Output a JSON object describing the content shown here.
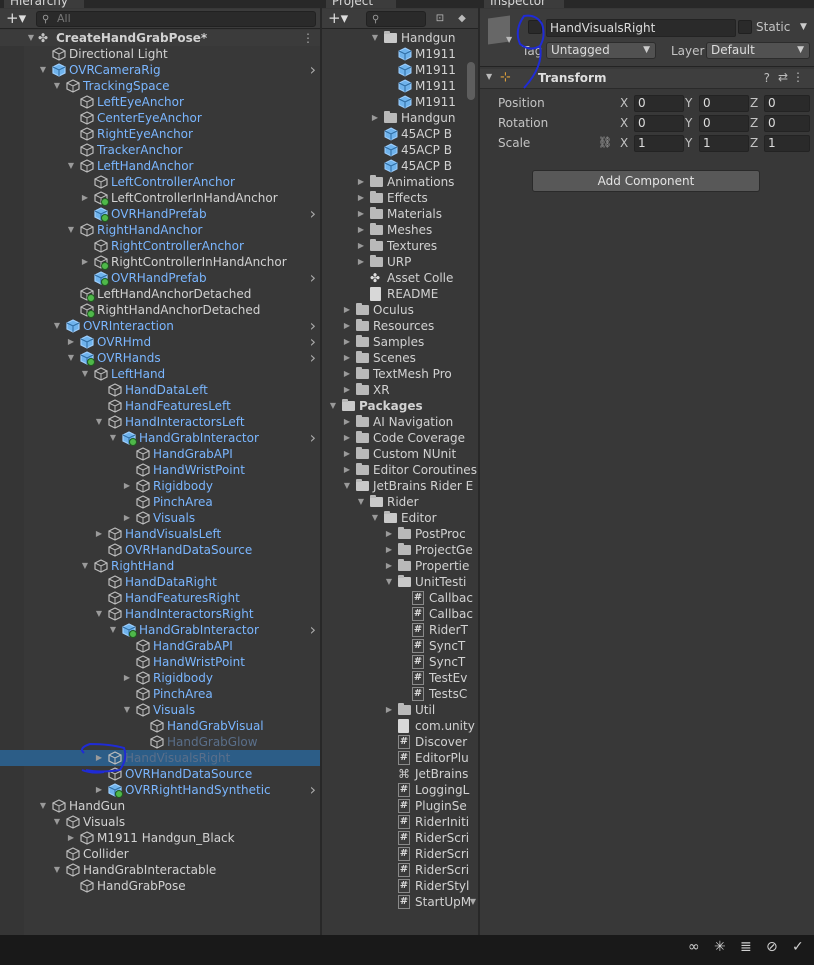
{
  "hierarchy": {
    "tab": "Hierarchy",
    "search_placeholder": "All",
    "scene": "CreateHandGrabPose*",
    "rows": [
      {
        "label": "Directional Light",
        "depth": 1,
        "color": "white",
        "arrow": "",
        "icon": "cube"
      },
      {
        "label": "OVRCameraRig",
        "depth": 1,
        "color": "blue",
        "arrow": "down",
        "icon": "prefab",
        "chev": true
      },
      {
        "label": "TrackingSpace",
        "depth": 2,
        "color": "blue",
        "arrow": "down",
        "icon": "cube"
      },
      {
        "label": "LeftEyeAnchor",
        "depth": 3,
        "color": "blue",
        "arrow": "",
        "icon": "cube"
      },
      {
        "label": "CenterEyeAnchor",
        "depth": 3,
        "color": "blue",
        "arrow": "",
        "icon": "cube"
      },
      {
        "label": "RightEyeAnchor",
        "depth": 3,
        "color": "blue",
        "arrow": "",
        "icon": "cube"
      },
      {
        "label": "TrackerAnchor",
        "depth": 3,
        "color": "blue",
        "arrow": "",
        "icon": "cube"
      },
      {
        "label": "LeftHandAnchor",
        "depth": 3,
        "color": "blue",
        "arrow": "down",
        "icon": "cube"
      },
      {
        "label": "LeftControllerAnchor",
        "depth": 4,
        "color": "blue",
        "arrow": "",
        "icon": "cube"
      },
      {
        "label": "LeftControllerInHandAnchor",
        "depth": 4,
        "color": "white",
        "arrow": "right",
        "icon": "cube-add"
      },
      {
        "label": "OVRHandPrefab",
        "depth": 4,
        "color": "blue",
        "arrow": "",
        "icon": "prefab-add",
        "chev": true
      },
      {
        "label": "RightHandAnchor",
        "depth": 3,
        "color": "blue",
        "arrow": "down",
        "icon": "cube"
      },
      {
        "label": "RightControllerAnchor",
        "depth": 4,
        "color": "blue",
        "arrow": "",
        "icon": "cube"
      },
      {
        "label": "RightControllerInHandAnchor",
        "depth": 4,
        "color": "white",
        "arrow": "right",
        "icon": "cube-add"
      },
      {
        "label": "OVRHandPrefab",
        "depth": 4,
        "color": "blue",
        "arrow": "",
        "icon": "prefab-add",
        "chev": true
      },
      {
        "label": "LeftHandAnchorDetached",
        "depth": 3,
        "color": "white",
        "arrow": "",
        "icon": "cube-add"
      },
      {
        "label": "RightHandAnchorDetached",
        "depth": 3,
        "color": "white",
        "arrow": "",
        "icon": "cube-add"
      },
      {
        "label": "OVRInteraction",
        "depth": 2,
        "color": "blue",
        "arrow": "down",
        "icon": "prefab",
        "chev": true
      },
      {
        "label": "OVRHmd",
        "depth": 3,
        "color": "blue",
        "arrow": "right",
        "icon": "prefab",
        "chev": true
      },
      {
        "label": "OVRHands",
        "depth": 3,
        "color": "blue",
        "arrow": "down",
        "icon": "prefab-add",
        "chev": true
      },
      {
        "label": "LeftHand",
        "depth": 4,
        "color": "blue",
        "arrow": "down",
        "icon": "cube"
      },
      {
        "label": "HandDataLeft",
        "depth": 5,
        "color": "blue",
        "arrow": "",
        "icon": "cube"
      },
      {
        "label": "HandFeaturesLeft",
        "depth": 5,
        "color": "blue",
        "arrow": "",
        "icon": "cube"
      },
      {
        "label": "HandInteractorsLeft",
        "depth": 5,
        "color": "blue",
        "arrow": "down",
        "icon": "cube"
      },
      {
        "label": "HandGrabInteractor",
        "depth": 6,
        "color": "blue",
        "arrow": "down",
        "icon": "prefab-add",
        "chev": true
      },
      {
        "label": "HandGrabAPI",
        "depth": 7,
        "color": "blue",
        "arrow": "",
        "icon": "cube"
      },
      {
        "label": "HandWristPoint",
        "depth": 7,
        "color": "blue",
        "arrow": "",
        "icon": "cube"
      },
      {
        "label": "Rigidbody",
        "depth": 7,
        "color": "blue",
        "arrow": "right",
        "icon": "cube"
      },
      {
        "label": "PinchArea",
        "depth": 7,
        "color": "blue",
        "arrow": "",
        "icon": "cube"
      },
      {
        "label": "Visuals",
        "depth": 7,
        "color": "blue",
        "arrow": "right",
        "icon": "cube"
      },
      {
        "label": "HandVisualsLeft",
        "depth": 5,
        "color": "blue",
        "arrow": "right",
        "icon": "cube"
      },
      {
        "label": "OVRHandDataSource",
        "depth": 5,
        "color": "blue",
        "arrow": "",
        "icon": "cube"
      },
      {
        "label": "RightHand",
        "depth": 4,
        "color": "blue",
        "arrow": "down",
        "icon": "cube"
      },
      {
        "label": "HandDataRight",
        "depth": 5,
        "color": "blue",
        "arrow": "",
        "icon": "cube"
      },
      {
        "label": "HandFeaturesRight",
        "depth": 5,
        "color": "blue",
        "arrow": "",
        "icon": "cube"
      },
      {
        "label": "HandInteractorsRight",
        "depth": 5,
        "color": "blue",
        "arrow": "down",
        "icon": "cube"
      },
      {
        "label": "HandGrabInteractor",
        "depth": 6,
        "color": "blue",
        "arrow": "down",
        "icon": "prefab-add",
        "chev": true
      },
      {
        "label": "HandGrabAPI",
        "depth": 7,
        "color": "blue",
        "arrow": "",
        "icon": "cube"
      },
      {
        "label": "HandWristPoint",
        "depth": 7,
        "color": "blue",
        "arrow": "",
        "icon": "cube"
      },
      {
        "label": "Rigidbody",
        "depth": 7,
        "color": "blue",
        "arrow": "right",
        "icon": "cube"
      },
      {
        "label": "PinchArea",
        "depth": 7,
        "color": "blue",
        "arrow": "",
        "icon": "cube"
      },
      {
        "label": "Visuals",
        "depth": 7,
        "color": "blue",
        "arrow": "down",
        "icon": "cube"
      },
      {
        "label": "HandGrabVisual",
        "depth": 8,
        "color": "blue",
        "arrow": "",
        "icon": "cube"
      },
      {
        "label": "HandGrabGlow",
        "depth": 8,
        "color": "dim",
        "arrow": "",
        "icon": "cube"
      },
      {
        "label": "HandVisualsRight",
        "depth": 5,
        "color": "dim",
        "arrow": "right",
        "icon": "cube",
        "selected": true
      },
      {
        "label": "OVRHandDataSource",
        "depth": 5,
        "color": "blue",
        "arrow": "",
        "icon": "cube"
      },
      {
        "label": "OVRRightHandSynthetic",
        "depth": 5,
        "color": "blue",
        "arrow": "right",
        "icon": "prefab-add",
        "chev": true
      },
      {
        "label": "HandGun",
        "depth": 1,
        "color": "white",
        "arrow": "down",
        "icon": "cube"
      },
      {
        "label": "Visuals",
        "depth": 2,
        "color": "white",
        "arrow": "down",
        "icon": "cube"
      },
      {
        "label": "M1911 Handgun_Black",
        "depth": 3,
        "color": "white",
        "arrow": "right",
        "icon": "cube"
      },
      {
        "label": "Collider",
        "depth": 2,
        "color": "white",
        "arrow": "",
        "icon": "cube"
      },
      {
        "label": "HandGrabInteractable",
        "depth": 2,
        "color": "white",
        "arrow": "down",
        "icon": "cube"
      },
      {
        "label": "HandGrabPose",
        "depth": 3,
        "color": "white",
        "arrow": "",
        "icon": "cube"
      }
    ]
  },
  "project": {
    "tab": "Project",
    "rows": [
      {
        "label": "Handgun",
        "indent": 3,
        "arrow": "down",
        "icon": "folder"
      },
      {
        "label": "M1911",
        "indent": 4,
        "arrow": "",
        "icon": "mesh"
      },
      {
        "label": "M1911",
        "indent": 4,
        "arrow": "",
        "icon": "mesh"
      },
      {
        "label": "M1911",
        "indent": 4,
        "arrow": "",
        "icon": "mesh"
      },
      {
        "label": "M1911",
        "indent": 4,
        "arrow": "",
        "icon": "mesh"
      },
      {
        "label": "Handgun",
        "indent": 3,
        "arrow": "right",
        "icon": "folder"
      },
      {
        "label": "45ACP B",
        "indent": 3,
        "arrow": "",
        "icon": "prefab"
      },
      {
        "label": "45ACP B",
        "indent": 3,
        "arrow": "",
        "icon": "prefab"
      },
      {
        "label": "45ACP B",
        "indent": 3,
        "arrow": "",
        "icon": "prefab"
      },
      {
        "label": "Animations",
        "indent": 2,
        "arrow": "right",
        "icon": "folder"
      },
      {
        "label": "Effects",
        "indent": 2,
        "arrow": "right",
        "icon": "folder"
      },
      {
        "label": "Materials",
        "indent": 2,
        "arrow": "right",
        "icon": "folder"
      },
      {
        "label": "Meshes",
        "indent": 2,
        "arrow": "right",
        "icon": "folder"
      },
      {
        "label": "Textures",
        "indent": 2,
        "arrow": "right",
        "icon": "folder"
      },
      {
        "label": "URP",
        "indent": 2,
        "arrow": "right",
        "icon": "folder"
      },
      {
        "label": "Asset Colle",
        "indent": 2,
        "arrow": "",
        "icon": "unity"
      },
      {
        "label": "README",
        "indent": 2,
        "arrow": "",
        "icon": "page"
      },
      {
        "label": "Oculus",
        "indent": 1,
        "arrow": "right",
        "icon": "folder"
      },
      {
        "label": "Resources",
        "indent": 1,
        "arrow": "right",
        "icon": "folder"
      },
      {
        "label": "Samples",
        "indent": 1,
        "arrow": "right",
        "icon": "folder"
      },
      {
        "label": "Scenes",
        "indent": 1,
        "arrow": "right",
        "icon": "folder"
      },
      {
        "label": "TextMesh Pro",
        "indent": 1,
        "arrow": "right",
        "icon": "folder"
      },
      {
        "label": "XR",
        "indent": 1,
        "arrow": "right",
        "icon": "folder"
      },
      {
        "label": "Packages",
        "indent": 0,
        "arrow": "down",
        "icon": "folder",
        "bold": true
      },
      {
        "label": "AI Navigation",
        "indent": 1,
        "arrow": "right",
        "icon": "folder"
      },
      {
        "label": "Code Coverage",
        "indent": 1,
        "arrow": "right",
        "icon": "folder"
      },
      {
        "label": "Custom NUnit",
        "indent": 1,
        "arrow": "right",
        "icon": "folder"
      },
      {
        "label": "Editor Coroutines",
        "indent": 1,
        "arrow": "right",
        "icon": "folder"
      },
      {
        "label": "JetBrains Rider E",
        "indent": 1,
        "arrow": "down",
        "icon": "folder"
      },
      {
        "label": "Rider",
        "indent": 2,
        "arrow": "down",
        "icon": "folder"
      },
      {
        "label": "Editor",
        "indent": 3,
        "arrow": "down",
        "icon": "folder"
      },
      {
        "label": "PostProc",
        "indent": 4,
        "arrow": "right",
        "icon": "folder"
      },
      {
        "label": "ProjectGe",
        "indent": 4,
        "arrow": "right",
        "icon": "folder"
      },
      {
        "label": "Propertie",
        "indent": 4,
        "arrow": "right",
        "icon": "folder"
      },
      {
        "label": "UnitTesti",
        "indent": 4,
        "arrow": "down",
        "icon": "folder"
      },
      {
        "label": "Callbac",
        "indent": 5,
        "arrow": "",
        "icon": "hash"
      },
      {
        "label": "Callbac",
        "indent": 5,
        "arrow": "",
        "icon": "hash"
      },
      {
        "label": "RiderT",
        "indent": 5,
        "arrow": "",
        "icon": "hash"
      },
      {
        "label": "SyncT",
        "indent": 5,
        "arrow": "",
        "icon": "hash"
      },
      {
        "label": "SyncT",
        "indent": 5,
        "arrow": "",
        "icon": "hash"
      },
      {
        "label": "TestEv",
        "indent": 5,
        "arrow": "",
        "icon": "hash"
      },
      {
        "label": "TestsC",
        "indent": 5,
        "arrow": "",
        "icon": "hash"
      },
      {
        "label": "Util",
        "indent": 4,
        "arrow": "right",
        "icon": "folder"
      },
      {
        "label": "com.unity",
        "indent": 4,
        "arrow": "",
        "icon": "page"
      },
      {
        "label": "Discover",
        "indent": 4,
        "arrow": "",
        "icon": "hash"
      },
      {
        "label": "EditorPlu",
        "indent": 4,
        "arrow": "",
        "icon": "hash"
      },
      {
        "label": "JetBrains",
        "indent": 4,
        "arrow": "",
        "icon": "dll"
      },
      {
        "label": "LoggingL",
        "indent": 4,
        "arrow": "",
        "icon": "hash"
      },
      {
        "label": "PluginSe",
        "indent": 4,
        "arrow": "",
        "icon": "hash"
      },
      {
        "label": "RiderIniti",
        "indent": 4,
        "arrow": "",
        "icon": "hash"
      },
      {
        "label": "RiderScri",
        "indent": 4,
        "arrow": "",
        "icon": "hash"
      },
      {
        "label": "RiderScri",
        "indent": 4,
        "arrow": "",
        "icon": "hash"
      },
      {
        "label": "RiderScri",
        "indent": 4,
        "arrow": "",
        "icon": "hash"
      },
      {
        "label": "RiderStyl",
        "indent": 4,
        "arrow": "",
        "icon": "hash"
      },
      {
        "label": "StartUpM",
        "indent": 4,
        "arrow": "",
        "icon": "hash"
      }
    ]
  },
  "inspector": {
    "tab": "Inspector",
    "object_name": "HandVisualsRight",
    "static_label": "Static",
    "tag_label": "Tag",
    "tag_value": "Untagged",
    "layer_label": "Layer",
    "layer_value": "Default",
    "component_title": "Transform",
    "position_label": "Position",
    "rotation_label": "Rotation",
    "scale_label": "Scale",
    "x": "X",
    "y": "Y",
    "z": "Z",
    "position": [
      "0",
      "0",
      "0"
    ],
    "rotation": [
      "0",
      "0",
      "0"
    ],
    "scale": [
      "1",
      "1",
      "1"
    ],
    "add_component": "Add Component"
  },
  "colors": {
    "accent": "#3a79bb",
    "prefab_blue": "#7ab6ff",
    "selection": "#2c5d87",
    "annotation": "#1f2bd6"
  }
}
